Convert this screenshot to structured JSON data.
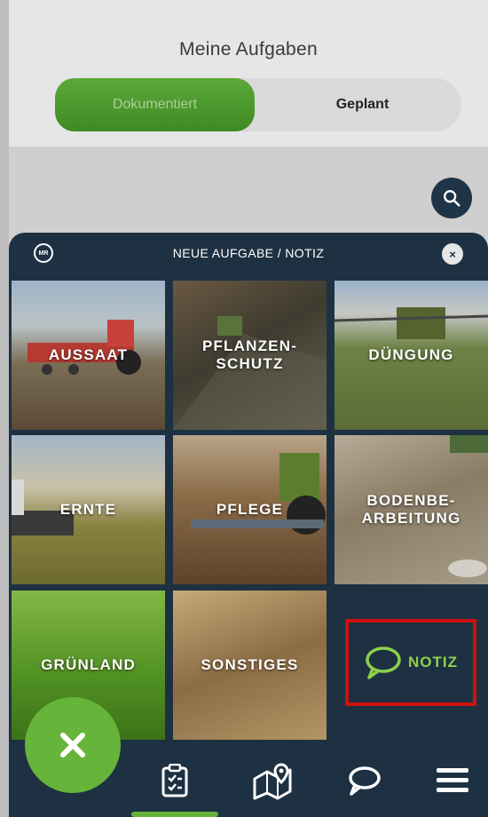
{
  "header": {
    "title": "Meine Aufgaben",
    "tabs": [
      {
        "label": "Dokumentiert",
        "active": true
      },
      {
        "label": "Geplant",
        "active": false
      }
    ]
  },
  "search": {
    "icon": "search-icon"
  },
  "sheet": {
    "logo_text": "MR",
    "title": "NEUE AUFGABE / NOTIZ",
    "close_label": "×",
    "tiles": [
      {
        "label": "AUSSAAT"
      },
      {
        "label_line1": "PFLANZEN-",
        "label_line2": "SCHUTZ"
      },
      {
        "label": "DÜNGUNG"
      },
      {
        "label": "ERNTE"
      },
      {
        "label": "PFLEGE"
      },
      {
        "label_line1": "BODENBE-",
        "label_line2": "ARBEITUNG"
      },
      {
        "label": "GRÜNLAND"
      },
      {
        "label": "SONSTIGES"
      },
      {
        "label": "NOTIZ",
        "icon": "speech-bubble-icon",
        "highlight_color": "#cc1111"
      }
    ]
  },
  "fab": {
    "label": "×",
    "color": "#66b43a"
  },
  "bottom_nav": {
    "items": [
      {
        "icon": "clipboard-icon",
        "active": true
      },
      {
        "icon": "map-pin-icon"
      },
      {
        "icon": "chat-icon"
      },
      {
        "icon": "menu-icon"
      }
    ]
  },
  "colors": {
    "accent": "#66b43a",
    "navy": "#1e3142",
    "notiz_text": "#8ed04b"
  }
}
